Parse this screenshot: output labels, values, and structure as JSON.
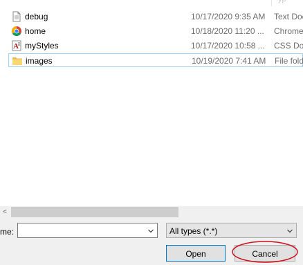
{
  "header": {
    "type_col_fragment": "yp"
  },
  "files": [
    {
      "name": "debug",
      "date": "10/17/2020 9:35 AM",
      "type": "Text Doc",
      "icon": "text-document-icon",
      "selected": false
    },
    {
      "name": "home",
      "date": "10/18/2020 11:20 ...",
      "type": "Chrome",
      "icon": "chrome-icon",
      "selected": false
    },
    {
      "name": "myStyles",
      "date": "10/17/2020 10:58 ...",
      "type": "CSS Doc",
      "icon": "css-file-icon",
      "selected": false
    },
    {
      "name": "images",
      "date": "10/19/2020 7:41 AM",
      "type": "File fold",
      "icon": "folder-icon",
      "selected": true
    }
  ],
  "scrollbar": {
    "left_arrow": "<"
  },
  "bottom": {
    "filename_label": "me:",
    "filename_value": "",
    "filetype_value": "All types (*.*)",
    "open_label": "Open",
    "cancel_label": "Cancel"
  },
  "colors": {
    "selection_border": "#99d1ff",
    "primary_button_border": "#0078d7",
    "annotation_circle": "#d0111b",
    "folder": "#f8d775"
  }
}
